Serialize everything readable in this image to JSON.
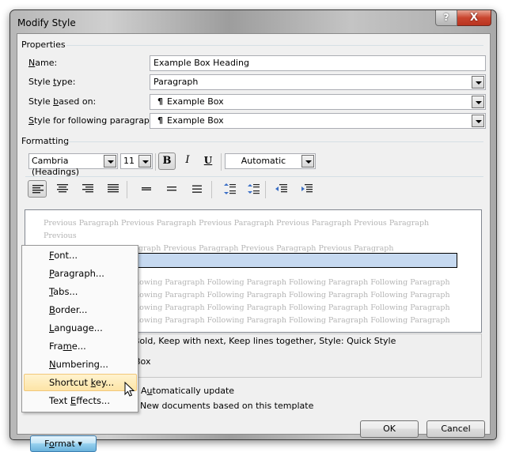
{
  "window": {
    "title": "Modify Style",
    "help_label": "?",
    "close_label": "X"
  },
  "properties": {
    "group_label": "Properties",
    "name_label_u": "N",
    "name_label_rest": "ame:",
    "name_value": "Example Box Heading",
    "style_type_label_a": "Style ",
    "style_type_label_u": "t",
    "style_type_label_b": "ype:",
    "style_type_value": "Paragraph",
    "based_on_label_a": "Style ",
    "based_on_label_u": "b",
    "based_on_label_b": "ased on:",
    "based_on_value": "Example Box",
    "following_label_u": "S",
    "following_label_rest": "tyle for following paragraph:",
    "following_value": "Example Box",
    "pilcrow": "¶"
  },
  "formatting": {
    "group_label": "Formatting",
    "font_name": "Cambria (Headings)",
    "font_size": "11",
    "bold_label": "B",
    "italic_label": "I",
    "underline_label": "U",
    "color_value": "Automatic",
    "bold_pressed": true,
    "align_pressed": "align-left"
  },
  "preview": {
    "previous_line1": "Previous Paragraph Previous Paragraph Previous Paragraph Previous Paragraph Previous Paragraph Previous",
    "previous_line2": "Paragraph Previous Paragraph Previous Paragraph Previous Paragraph Previous Paragraph",
    "following_lines": [
      "Following Paragraph Following Paragraph Following Paragraph Following Paragraph Following Paragraph",
      "Following Paragraph Following Paragraph Following Paragraph Following Paragraph Following Paragraph",
      "Following Paragraph Following Paragraph Following Paragraph Following Paragraph Following Paragraph",
      "Following Paragraph Following Paragraph Following Paragraph Following Paragraph Following Paragraph"
    ],
    "heading_box_color": "#c6d9f0"
  },
  "description": {
    "line1_visible": "Bold, Keep with next, Keep lines together, Style: Quick Style",
    "line2_visible": "Box"
  },
  "options": {
    "auto_update_a": "A",
    "auto_update_u": "u",
    "auto_update_b": "tomatically update",
    "new_docs_label": "New documents based on this template"
  },
  "buttons": {
    "format_a": "F",
    "format_u": "o",
    "format_b": "rmat",
    "format_arrow": "▾",
    "ok_label": "OK",
    "cancel_label": "Cancel"
  },
  "format_menu": {
    "items": [
      {
        "pre": "",
        "u": "F",
        "post": "ont..."
      },
      {
        "pre": "",
        "u": "P",
        "post": "aragraph..."
      },
      {
        "pre": "",
        "u": "T",
        "post": "abs..."
      },
      {
        "pre": "",
        "u": "B",
        "post": "order..."
      },
      {
        "pre": "",
        "u": "L",
        "post": "anguage..."
      },
      {
        "pre": "Fra",
        "u": "m",
        "post": "e..."
      },
      {
        "pre": "",
        "u": "N",
        "post": "umbering..."
      },
      {
        "pre": "Shortcut ",
        "u": "k",
        "post": "ey..."
      },
      {
        "pre": "Text ",
        "u": "E",
        "post": "ffects..."
      }
    ],
    "highlighted_index": 7,
    "highlight_color": "#fde4a6"
  }
}
